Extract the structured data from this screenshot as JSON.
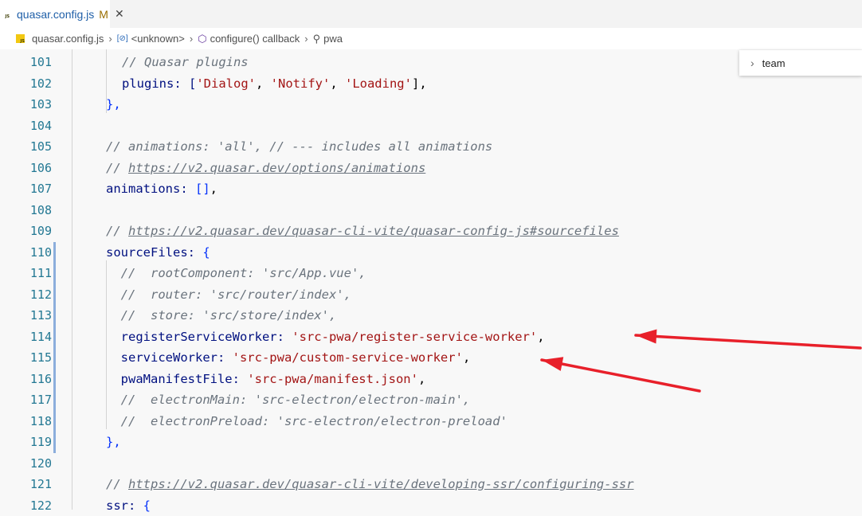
{
  "tab": {
    "label": "quasar.config.js",
    "modified": "M",
    "close": "✕"
  },
  "breadcrumb": {
    "file": "quasar.config.js",
    "unknown": "<unknown>",
    "callback": "configure() callback",
    "last": "pwa"
  },
  "find": {
    "value": "team"
  },
  "lines": [
    {
      "n": "101",
      "segs": [
        {
          "t": "// Quasar plugins",
          "c": "c"
        }
      ]
    },
    {
      "n": "102",
      "segs": [
        {
          "t": "plugins: [",
          "c": "k"
        },
        {
          "t": "'Dialog'",
          "c": "s"
        },
        {
          "t": ", ",
          "c": "punct"
        },
        {
          "t": "'Notify'",
          "c": "s"
        },
        {
          "t": ", ",
          "c": "punct"
        },
        {
          "t": "'Loading'",
          "c": "s"
        },
        {
          "t": "],",
          "c": "punct"
        }
      ]
    },
    {
      "n": "103",
      "segs": [
        {
          "t": "},",
          "c": "p"
        }
      ]
    },
    {
      "n": "104",
      "segs": []
    },
    {
      "n": "105",
      "segs": [
        {
          "t": "// animations: 'all', // --- includes all animations",
          "c": "c"
        }
      ]
    },
    {
      "n": "106",
      "segs": [
        {
          "t": "// ",
          "c": "c"
        },
        {
          "t": "https://v2.quasar.dev/options/animations",
          "c": "c u"
        }
      ]
    },
    {
      "n": "107",
      "segs": [
        {
          "t": "animations: ",
          "c": "k"
        },
        {
          "t": "[]",
          "c": "p"
        },
        {
          "t": ",",
          "c": "punct"
        }
      ]
    },
    {
      "n": "108",
      "segs": []
    },
    {
      "n": "109",
      "segs": [
        {
          "t": "// ",
          "c": "c"
        },
        {
          "t": "https://v2.quasar.dev/quasar-cli-vite/quasar-config-js#sourcefiles",
          "c": "c u"
        }
      ]
    },
    {
      "n": "110",
      "segs": [
        {
          "t": "sourceFiles: ",
          "c": "k"
        },
        {
          "t": "{",
          "c": "p"
        }
      ]
    },
    {
      "n": "111",
      "segs": [
        {
          "t": "  //  rootComponent: 'src/App.vue',",
          "c": "c"
        }
      ]
    },
    {
      "n": "112",
      "segs": [
        {
          "t": "  //  router: 'src/router/index',",
          "c": "c"
        }
      ]
    },
    {
      "n": "113",
      "segs": [
        {
          "t": "  //  store: 'src/store/index',",
          "c": "c"
        }
      ]
    },
    {
      "n": "114",
      "segs": [
        {
          "t": "  registerServiceWorker: ",
          "c": "k"
        },
        {
          "t": "'src-pwa/register-service-worker'",
          "c": "s"
        },
        {
          "t": ",",
          "c": "punct"
        }
      ]
    },
    {
      "n": "115",
      "segs": [
        {
          "t": "  serviceWorker: ",
          "c": "k"
        },
        {
          "t": "'src-pwa/custom-service-worker'",
          "c": "s"
        },
        {
          "t": ",",
          "c": "punct"
        }
      ]
    },
    {
      "n": "116",
      "segs": [
        {
          "t": "  pwaManifestFile: ",
          "c": "k"
        },
        {
          "t": "'src-pwa/manifest.json'",
          "c": "s"
        },
        {
          "t": ",",
          "c": "punct"
        }
      ]
    },
    {
      "n": "117",
      "segs": [
        {
          "t": "  //  electronMain: 'src-electron/electron-main',",
          "c": "c"
        }
      ]
    },
    {
      "n": "118",
      "segs": [
        {
          "t": "  //  electronPreload: 'src-electron/electron-preload'",
          "c": "c"
        }
      ]
    },
    {
      "n": "119",
      "segs": [
        {
          "t": "},",
          "c": "p"
        }
      ]
    },
    {
      "n": "120",
      "segs": []
    },
    {
      "n": "121",
      "segs": [
        {
          "t": "// ",
          "c": "c"
        },
        {
          "t": "https://v2.quasar.dev/quasar-cli-vite/developing-ssr/configuring-ssr",
          "c": "c u"
        }
      ]
    },
    {
      "n": "122",
      "segs": [
        {
          "t": "ssr: ",
          "c": "k"
        },
        {
          "t": "{",
          "c": "p"
        }
      ]
    }
  ],
  "colors": {
    "annotation_arrow": "#e8202a"
  }
}
